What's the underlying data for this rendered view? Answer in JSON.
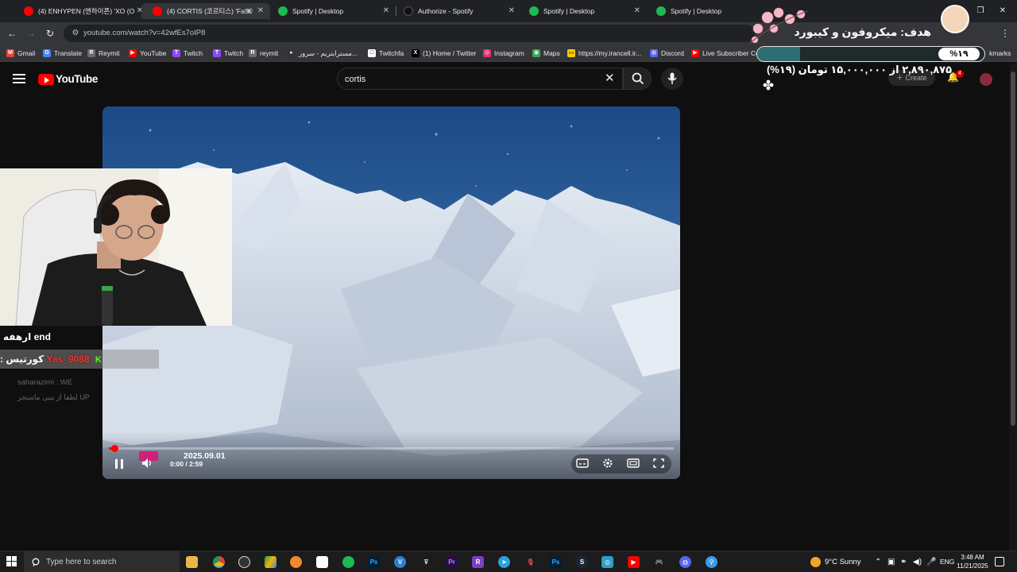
{
  "browser": {
    "tabs": [
      {
        "title": "(4) ENHYPEN (엔하이픈) 'XO (O",
        "favicon_color": "#ff0000",
        "active": false
      },
      {
        "title": "(4) CORTIS (코르티스) 'FaSt",
        "favicon_color": "#ff0000",
        "active": true
      },
      {
        "title": "Spotify | Desktop",
        "favicon_color": "#1db954",
        "active": false
      },
      {
        "title": "Authorize - Spotify",
        "favicon_color": "#000000",
        "active": false
      },
      {
        "title": "Spotify | Desktop",
        "favicon_color": "#1db954",
        "active": false
      },
      {
        "title": "Spotify | Desktop",
        "favicon_color": "#1db954",
        "active": false
      }
    ],
    "url": "youtube.com/watch?v=42wfEs7oIP8",
    "bookmarks": [
      {
        "label": "Gmail",
        "icon": "M",
        "color": "#ea4335"
      },
      {
        "label": "Translate",
        "icon": "G",
        "color": "#4285f4"
      },
      {
        "label": "Reymit",
        "icon": "R",
        "color": "#6b6b6b"
      },
      {
        "label": "YouTube",
        "icon": "▶",
        "color": "#ff0000"
      },
      {
        "label": "Twitch",
        "icon": "T",
        "color": "#9146ff"
      },
      {
        "label": "Twitch",
        "icon": "T",
        "color": "#9146ff"
      },
      {
        "label": "reymit",
        "icon": "R",
        "color": "#6b6b6b"
      },
      {
        "label": "مسترابتریم - سرور...",
        "icon": "▸",
        "color": "#333333"
      },
      {
        "label": "Twitchfa",
        "icon": "□",
        "color": "#ffffff"
      },
      {
        "label": "(1) Home / Twitter",
        "icon": "X",
        "color": "#000000"
      },
      {
        "label": "Instagram",
        "icon": "◎",
        "color": "#e1306c"
      },
      {
        "label": "Maps",
        "icon": "◉",
        "color": "#34a853"
      },
      {
        "label": "https://my.irancell.ir...",
        "icon": "▭",
        "color": "#ffcc00"
      },
      {
        "label": "Discord",
        "icon": "◍",
        "color": "#5865f2"
      },
      {
        "label": "Live Subscriber Co",
        "icon": "▶",
        "color": "#ff0000"
      },
      {
        "label": "kmarks",
        "icon": "",
        "color": "#35363a"
      }
    ]
  },
  "youtube": {
    "logo_text": "YouTube",
    "search_query": "cortis",
    "create_label": "Create",
    "notification_count": "4"
  },
  "player": {
    "overlay_date": "2025.09.01",
    "current_time": "0:00 / 2:59",
    "progress_fraction": 0.01
  },
  "stream_overlay": {
    "chat": [
      {
        "text": "end ارهفه",
        "color": "#ffffff"
      },
      {
        "user": "Yas_9088",
        "message": "کورتیس :",
        "user_color": "#e23b3b"
      },
      {
        "text": "saharazimi : WE",
        "color": "#555555"
      },
      {
        "text": "UP لطفا از بیبی ماسنجر",
        "color": "#555555"
      }
    ],
    "goal_title": "هدف: میکروفون و کیبورد",
    "goal_percent": "%۱۹",
    "goal_fraction": 0.19,
    "goal_amount": "۲,۸۹۰,۸۷۵ از ۱۵,۰۰۰,۰۰۰ تومان (۱۹%)"
  },
  "taskbar": {
    "search_placeholder": "Type here to search",
    "weather": "9°C  Sunny",
    "language": "ENG",
    "time": "3:48 AM",
    "date": "11/21/2025"
  }
}
